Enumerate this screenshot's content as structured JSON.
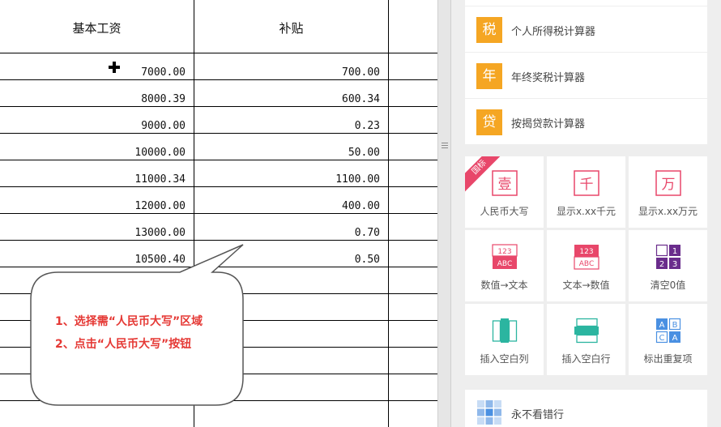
{
  "sheet": {
    "headers": {
      "base_salary": "基本工资",
      "subsidy": "补贴"
    },
    "rows": [
      {
        "base": "7000.00",
        "subsidy": "700.00"
      },
      {
        "base": "8000.39",
        "subsidy": "600.34"
      },
      {
        "base": "9000.00",
        "subsidy": "0.23"
      },
      {
        "base": "10000.00",
        "subsidy": "50.00"
      },
      {
        "base": "11000.34",
        "subsidy": "1100.00"
      },
      {
        "base": "12000.00",
        "subsidy": "400.00"
      },
      {
        "base": "13000.00",
        "subsidy": "0.70"
      },
      {
        "base": "10500.40",
        "subsidy": "0.50"
      }
    ]
  },
  "callout": {
    "line1": "1、选择需“人民币大写”区域",
    "line2": "2、点击“人民币大写”按钮"
  },
  "panel": {
    "calculators": [
      {
        "icon_char": "税",
        "label": "个人所得税计算器"
      },
      {
        "icon_char": "年",
        "label": "年终奖税计算器"
      },
      {
        "icon_char": "贷",
        "label": "按揭贷款计算器"
      }
    ],
    "badge": "国标",
    "tools": [
      {
        "label": "人民币大写",
        "icon": "rmb-uppercase-icon",
        "glyph": "壹"
      },
      {
        "label": "显示x.xx千元",
        "icon": "thousand-icon",
        "glyph": "千"
      },
      {
        "label": "显示x.xx万元",
        "icon": "ten-thousand-icon",
        "glyph": "万"
      },
      {
        "label": "数值→文本",
        "icon": "number-to-text-icon",
        "top": "123",
        "bottom": "ABC"
      },
      {
        "label": "文本→数值",
        "icon": "text-to-number-icon",
        "top": "123",
        "bottom": "ABC"
      },
      {
        "label": "清空0值",
        "icon": "clear-zero-icon",
        "nums": [
          "1",
          "2",
          "3"
        ]
      },
      {
        "label": "插入空白列",
        "icon": "insert-blank-column-icon"
      },
      {
        "label": "插入空白行",
        "icon": "insert-blank-row-icon"
      },
      {
        "label": "标出重复项",
        "icon": "mark-duplicates-icon",
        "letters": [
          "A",
          "B",
          "C",
          "A"
        ]
      }
    ],
    "bottom_tool": {
      "label": "永不看错行",
      "icon": "row-highlight-icon"
    }
  },
  "colors": {
    "accent_orange": "#f5a623",
    "accent_red": "#e8476a",
    "purple": "#6a2c8c",
    "teal": "#2bb5a0",
    "blue": "#4a90e2"
  }
}
